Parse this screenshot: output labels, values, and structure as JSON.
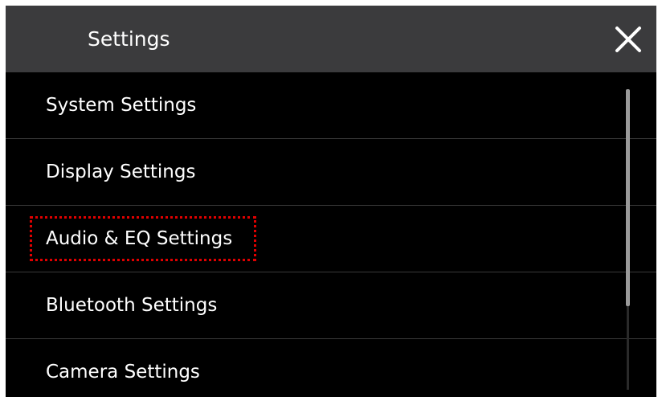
{
  "header": {
    "title": "Settings",
    "close_icon": "close-icon"
  },
  "settings_list": [
    {
      "label": "System Settings"
    },
    {
      "label": "Display Settings"
    },
    {
      "label": "Audio & EQ Settings"
    },
    {
      "label": "Bluetooth Settings"
    },
    {
      "label": "Camera Settings"
    }
  ],
  "highlighted_item": "Bluetooth Settings",
  "colors": {
    "header_bg": "#3b3b3d",
    "list_bg": "#000000",
    "text": "#ffffff",
    "highlight_border": "#e00000",
    "scroll_thumb": "#9a9a9a"
  }
}
